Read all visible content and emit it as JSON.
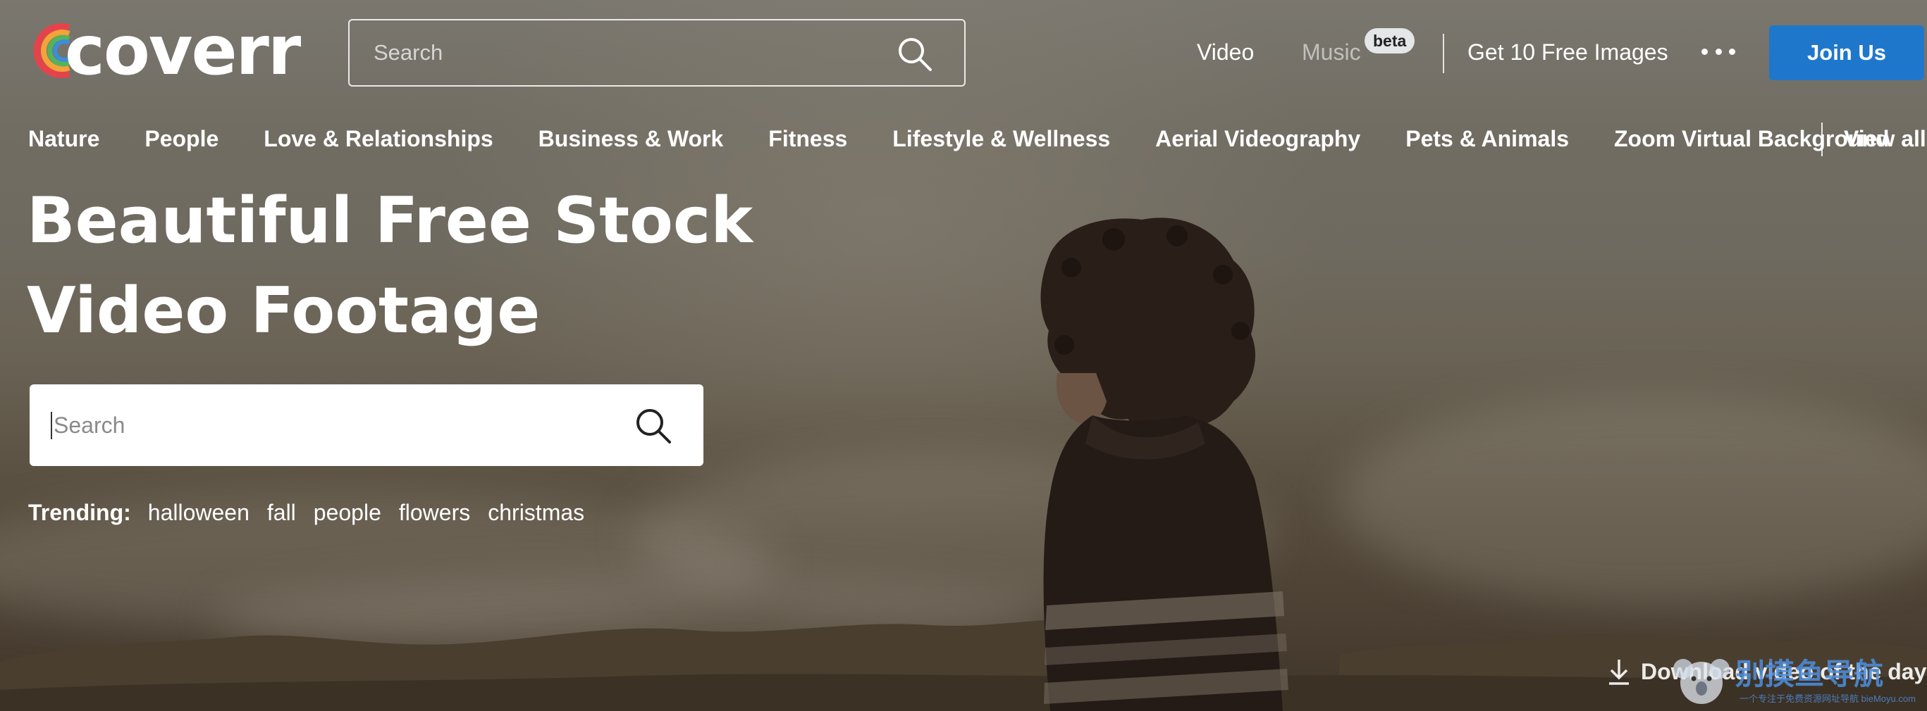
{
  "header": {
    "logo_text": "coverr",
    "search_placeholder": "Search",
    "nav": {
      "video": "Video",
      "music": "Music",
      "beta": "beta",
      "free_images": "Get 10 Free Images"
    },
    "join_label": "Join Us"
  },
  "categories": {
    "items": [
      "Nature",
      "People",
      "Love & Relationships",
      "Business & Work",
      "Fitness",
      "Lifestyle & Wellness",
      "Aerial Videography",
      "Pets & Animals",
      "Zoom Virtual Background"
    ],
    "view_all": "View all"
  },
  "hero": {
    "headline_line1": "Beautiful Free Stock",
    "headline_line2": "Video Footage",
    "search_placeholder": "Search",
    "trending_label": "Trending:",
    "trending_tags": [
      "halloween",
      "fall",
      "people",
      "flowers",
      "christmas"
    ]
  },
  "footer": {
    "download_label": "Download video of the day"
  },
  "watermark": {
    "title": "别摸鱼导航",
    "subtitle": "一个专注于免费资源网址导航 bieMoyu.com"
  },
  "colors": {
    "accent": "#1f77cc",
    "beta_badge": "#e4e6e8"
  }
}
